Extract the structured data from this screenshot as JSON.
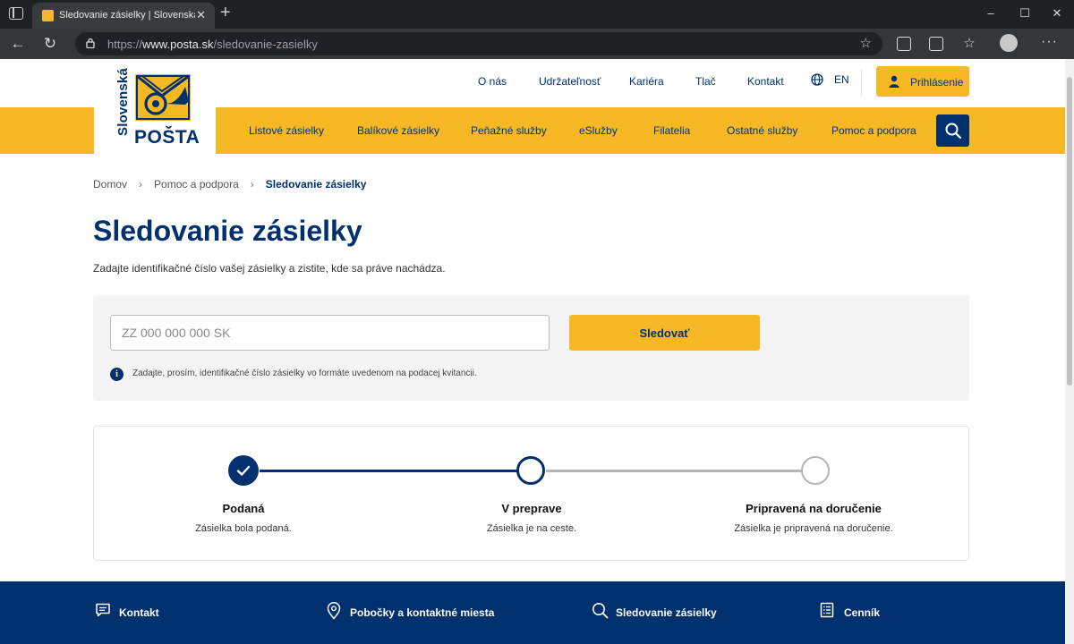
{
  "browser": {
    "tab_title": "Sledovanie zásielky | Slovenská pošta",
    "tab_close": "✕",
    "new_tab": "+",
    "url_prefix": "https://",
    "url_domain": "www.posta.sk",
    "url_path": "/sledovanie-zasielky",
    "window_controls": [
      "–",
      "☐",
      "✕"
    ]
  },
  "brand": {
    "name_vertical": "Slovenská",
    "name_main": "POŠTA",
    "color_primary": "#00306d",
    "color_accent": "#f7b826"
  },
  "topnav": {
    "links": [
      "O nás",
      "Udržateľnosť",
      "Kariéra",
      "Tlač",
      "Kontakt"
    ],
    "language": "EN",
    "login_label": "Prihlásenie"
  },
  "mainnav": {
    "items": [
      "Listové zásielky",
      "Balíkové zásielky",
      "Peňažné služby",
      "eSlužby",
      "Filatelia",
      "Ostatné služby",
      "Pomoc a podpora"
    ]
  },
  "breadcrumb": {
    "items": [
      "Domov",
      "Pomoc a podpora",
      "Sledovanie zásielky"
    ],
    "separator": "›"
  },
  "page": {
    "title": "Sledovanie zásielky",
    "intro": "Zadajte identifikačné číslo vašej zásielky a zistite, kde sa práve nachádza."
  },
  "tracking": {
    "input_placeholder": "ZZ 000 000 000 SK",
    "input_value": "",
    "button_label": "Sledovať",
    "info_icon": "i",
    "info_text": "Zadajte, prosím, identifikačné číslo zásielky vo formáte uvedenom na podacej kvitancii."
  },
  "progress": {
    "steps": [
      {
        "title": "Podaná",
        "description": "Zásielka bola podaná.",
        "state": "done"
      },
      {
        "title": "V preprave",
        "description": "Zásielka je na ceste.",
        "state": "current"
      },
      {
        "title": "Pripravená na doručenie",
        "description": "Zásielka je pripravená na doručenie.",
        "state": "pending"
      }
    ]
  },
  "footer": {
    "links": [
      {
        "label": "Kontakt",
        "icon": "chat-icon"
      },
      {
        "label": "Pobočky a kontaktné miesta",
        "icon": "location-pin-icon"
      },
      {
        "label": "Sledovanie zásielky",
        "icon": "search-icon"
      },
      {
        "label": "Cenník",
        "icon": "price-list-icon"
      }
    ]
  }
}
